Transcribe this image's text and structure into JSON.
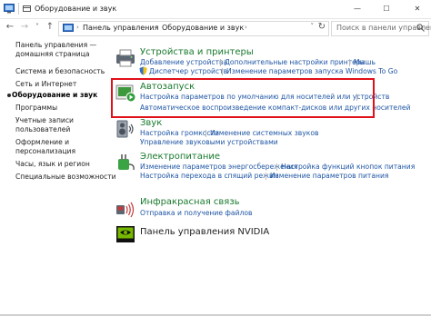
{
  "window": {
    "title": "Оборудование и звук",
    "controls": {
      "minimize": "—",
      "maximize": "☐",
      "close": "✕"
    }
  },
  "nav": {
    "back": "←",
    "forward": "→",
    "recent": "˅",
    "up": "↑",
    "breadcrumbs": [
      "Панель управления",
      "Оборудование и звук"
    ],
    "search_placeholder": "Поиск в панели управления"
  },
  "sidebar": {
    "items": [
      {
        "label": "Панель управления —"
      },
      {
        "label": "домашняя страница"
      },
      {
        "label": "Система и безопасность"
      },
      {
        "label": "Сеть и Интернет"
      },
      {
        "label": "Оборудование и звук",
        "active": true
      },
      {
        "label": "Программы"
      },
      {
        "label": "Учетные записи"
      },
      {
        "label": "пользователей"
      },
      {
        "label": "Оформление и"
      },
      {
        "label": "персонализация"
      },
      {
        "label": "Часы, язык и регион"
      },
      {
        "label": "Специальные возможности"
      }
    ]
  },
  "categories": [
    {
      "title": "Устройства и принтеры",
      "icon": "printer-icon",
      "links": [
        "Добавление устройства",
        "Дополнительные настройки принтера",
        "Мышь",
        "Диспетчер устройств",
        "Изменение параметров запуска Windows To Go"
      ]
    },
    {
      "title": "Автозапуск",
      "icon": "autoplay-icon",
      "links": [
        "Настройка параметров по умолчанию для носителей или устройств",
        "Автоматическое воспроизведение компакт-дисков или других носителей"
      ]
    },
    {
      "title": "Звук",
      "icon": "speaker-icon",
      "links": [
        "Настройка громкости",
        "Изменение системных звуков",
        "Управление звуковыми устройствами"
      ]
    },
    {
      "title": "Электропитание",
      "icon": "power-icon",
      "links": [
        "Изменение параметров энергосбережения",
        "Настройка функций кнопок питания",
        "Настройка перехода в спящий режим",
        "Изменение параметров питания"
      ]
    },
    {
      "title": "Инфракрасная связь",
      "icon": "infrared-icon",
      "links": [
        "Отправка и получение файлов"
      ]
    },
    {
      "title": "Панель управления NVIDIA",
      "icon": "nvidia-icon",
      "links": []
    }
  ],
  "colors": {
    "highlight_border": "#e00f18",
    "link": "#1f56a5",
    "heading": "#1a7a2e"
  }
}
